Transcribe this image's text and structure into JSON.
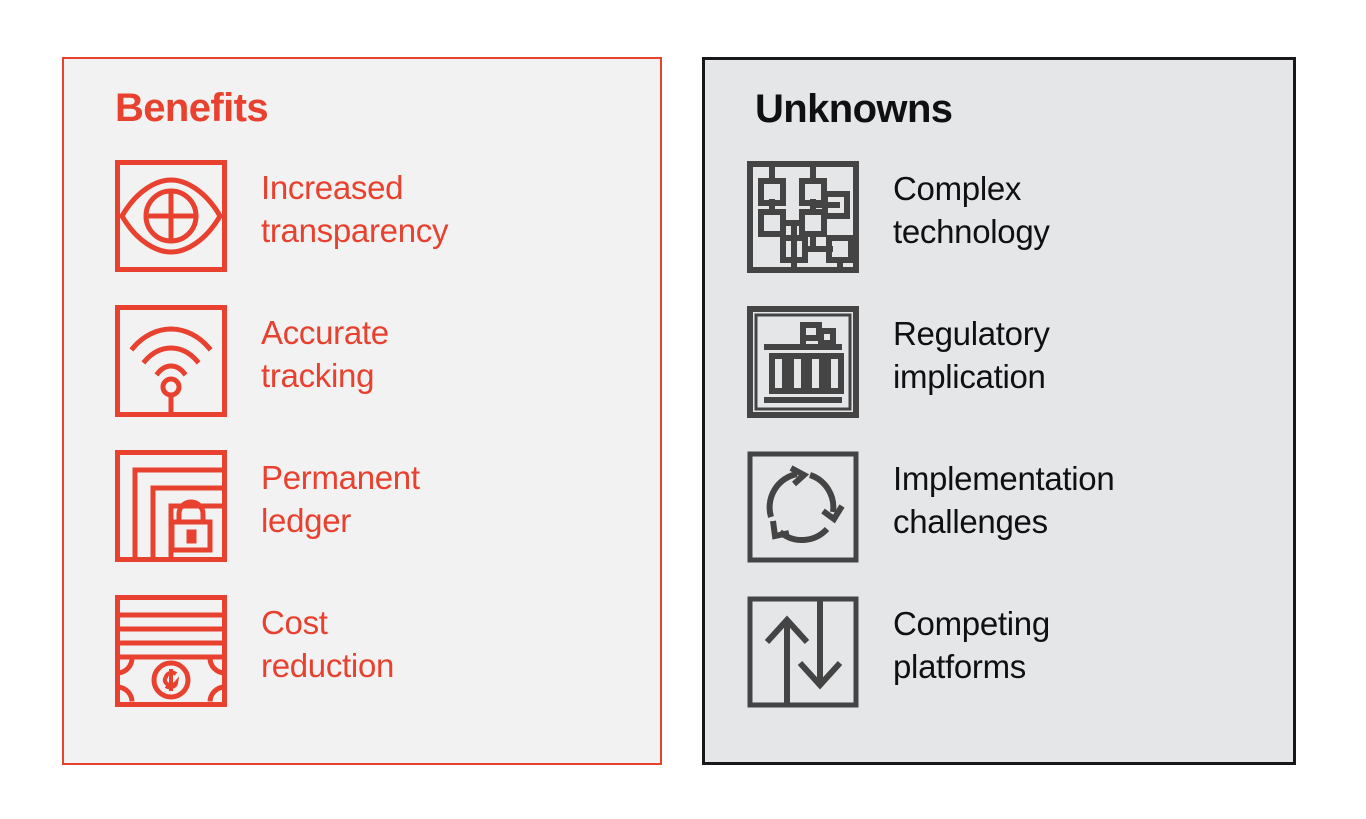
{
  "colors": {
    "benefit_accent": "#e8412f",
    "unknown_accent": "#101012",
    "benefit_panel_bg": "#f2f2f2",
    "unknown_panel_bg": "#e4e6e8",
    "page_bg": "#ffffff"
  },
  "panels": [
    {
      "id": "benefits",
      "title": "Benefits",
      "items": [
        {
          "icon": "eye-target-icon",
          "label": "Increased\ntransparency"
        },
        {
          "icon": "wireless-tracking-icon",
          "label": "Accurate\ntracking"
        },
        {
          "icon": "stacked-pages-lock-icon",
          "label": "Permanent\nledger"
        },
        {
          "icon": "banknote-stack-dollar-icon",
          "label": "Cost\nreduction"
        }
      ]
    },
    {
      "id": "unknowns",
      "title": "Unknowns",
      "items": [
        {
          "icon": "network-nodes-icon",
          "label": "Complex\ntechnology"
        },
        {
          "icon": "government-building-icon",
          "label": "Regulatory\nimplication"
        },
        {
          "icon": "circular-arrows-icon",
          "label": "Implementation\nchallenges"
        },
        {
          "icon": "up-down-arrows-icon",
          "label": "Competing\nplatforms"
        }
      ]
    }
  ]
}
